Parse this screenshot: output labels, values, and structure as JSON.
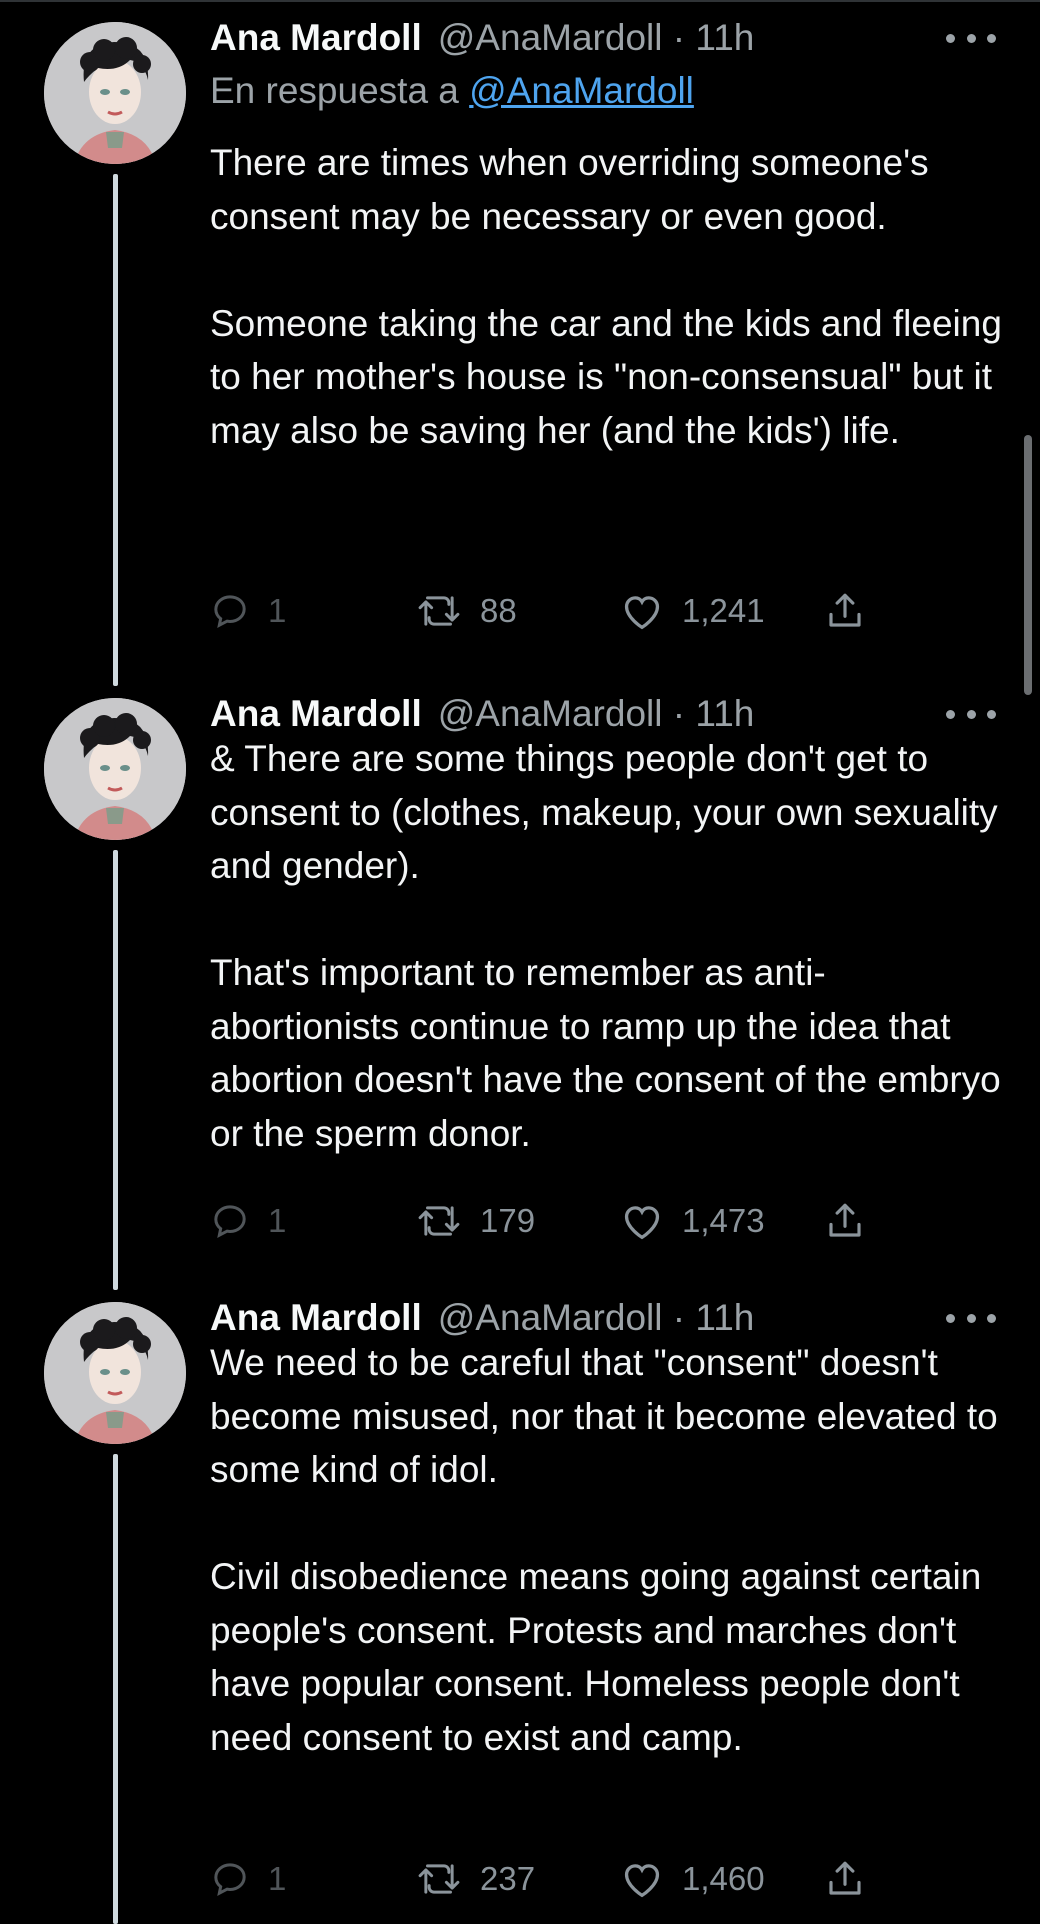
{
  "reply_context": {
    "prefix": "En respuesta a",
    "mention": "@AnaMardoll"
  },
  "tweets": [
    {
      "name": "Ana Mardoll",
      "handle": "@AnaMardoll",
      "separator": "·",
      "time": "11h",
      "paragraphs": [
        "There are times when overriding someone's consent may be necessary or even good.",
        "Someone taking the car and the kids and fleeing to her mother's house is \"non-consensual\" but it may also be saving her (and the kids') life."
      ],
      "replies": "1",
      "retweets": "88",
      "likes": "1,241"
    },
    {
      "name": "Ana Mardoll",
      "handle": "@AnaMardoll",
      "separator": "·",
      "time": "11h",
      "paragraphs": [
        "& There are some things people don't get to consent to (clothes, makeup, your own sexuality and gender).",
        "That's important to remember as anti-abortionists continue to ramp up the idea that abortion doesn't have the consent of the embryo or the sperm donor."
      ],
      "replies": "1",
      "retweets": "179",
      "likes": "1,473"
    },
    {
      "name": "Ana Mardoll",
      "handle": "@AnaMardoll",
      "separator": "·",
      "time": "11h",
      "paragraphs": [
        "We need to be careful that \"consent\" doesn't become misused, nor that it become elevated to some kind of idol.",
        "Civil disobedience means going against certain people's consent. Protests and marches don't have popular consent. Homeless people don't need consent to exist and camp."
      ],
      "replies": "1",
      "retweets": "237",
      "likes": "1,460"
    }
  ],
  "icons": {
    "reply": "reply-icon",
    "retweet": "retweet-icon",
    "like": "heart-icon",
    "share": "share-icon",
    "more": "more-icon"
  },
  "colors": {
    "background": "#000000",
    "text": "#f2f4f5",
    "secondary": "#9ca3a8",
    "link": "#4ea4ef",
    "thread_line": "#cfd9de"
  }
}
